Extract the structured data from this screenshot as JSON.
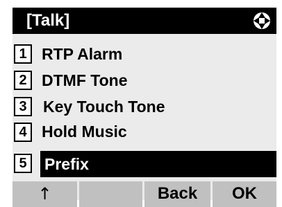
{
  "header": {
    "title": "[Talk]",
    "nav_icon": "four-way-nav-icon"
  },
  "menu": {
    "items": [
      {
        "number": "1",
        "label": "RTP Alarm",
        "selected": false
      },
      {
        "number": "2",
        "label": "DTMF Tone",
        "selected": false
      },
      {
        "number": "3",
        "label": "Key Touch Tone",
        "selected": false
      },
      {
        "number": "4",
        "label": "Hold Music",
        "selected": false
      },
      {
        "number": "5",
        "label": "Prefix",
        "selected": true
      }
    ]
  },
  "softkeys": {
    "key1": "↑",
    "key2": "",
    "key3": "Back",
    "key4": "OK"
  },
  "colors": {
    "panel_bg": "#ebebeb",
    "title_bg": "#000000",
    "selected_bg": "#000000",
    "softkey_bg": "#c0c0c0"
  }
}
